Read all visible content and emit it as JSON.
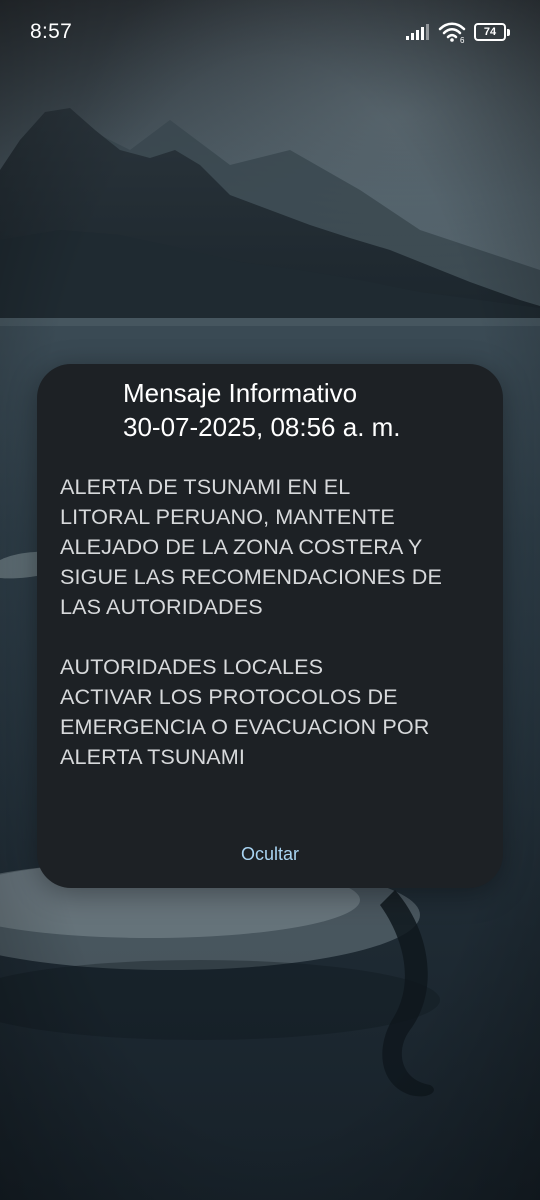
{
  "status_bar": {
    "time": "8:57",
    "battery_level": "74",
    "wifi_badge": "6",
    "icons": [
      "signal-icon",
      "wifi-icon",
      "battery-icon"
    ]
  },
  "dialog": {
    "title": "Mensaje Informativo",
    "date": "30-07-2025, 08:56 a. m.",
    "paragraph1": [
      "ALERTA DE TSUNAMI EN EL",
      "LITORAL PERUANO, MANTENTE",
      "ALEJADO DE LA ZONA COSTERA Y",
      "SIGUE LAS RECOMENDACIONES DE",
      "LAS AUTORIDADES"
    ],
    "paragraph2": [
      "AUTORIDADES LOCALES",
      "ACTIVAR LOS PROTOCOLOS DE",
      "EMERGENCIA O EVACUACION POR",
      "ALERTA TSUNAMI"
    ],
    "hide_label": "Ocultar"
  },
  "colors": {
    "dialog_background": "#1d2125",
    "message_text": "#d7d9db",
    "accent_link": "#a9d4f2",
    "wallpaper_water": "#24323d"
  }
}
